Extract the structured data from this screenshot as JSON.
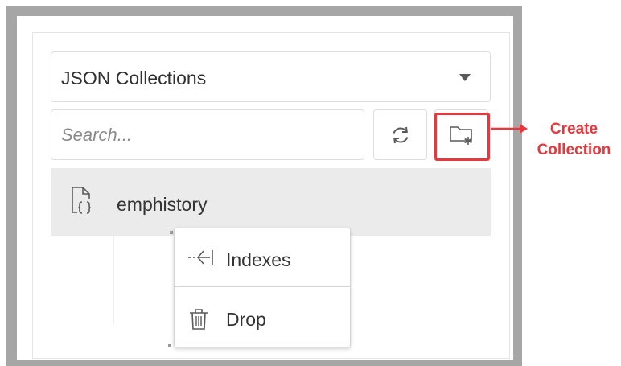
{
  "collection_type_select": {
    "selected": "JSON Collections",
    "icon": "caret-down-icon"
  },
  "search": {
    "placeholder": "Search..."
  },
  "toolbar": {
    "refresh_icon": "refresh-icon",
    "create_collection_icon": "folder-asterisk-icon"
  },
  "annotation": {
    "text": "Create Collection",
    "color": "#e8383d"
  },
  "collections": [
    {
      "name": "emphistory",
      "icon": "json-document-icon",
      "selected": true
    }
  ],
  "context_menu": {
    "items": [
      {
        "label": "Indexes",
        "icon": "indexes-icon"
      },
      {
        "label": "Drop",
        "icon": "trash-icon"
      }
    ]
  },
  "colors": {
    "frame": "#a6a6a6",
    "selected_row": "#ebebeb",
    "highlight": "#e8383d"
  }
}
